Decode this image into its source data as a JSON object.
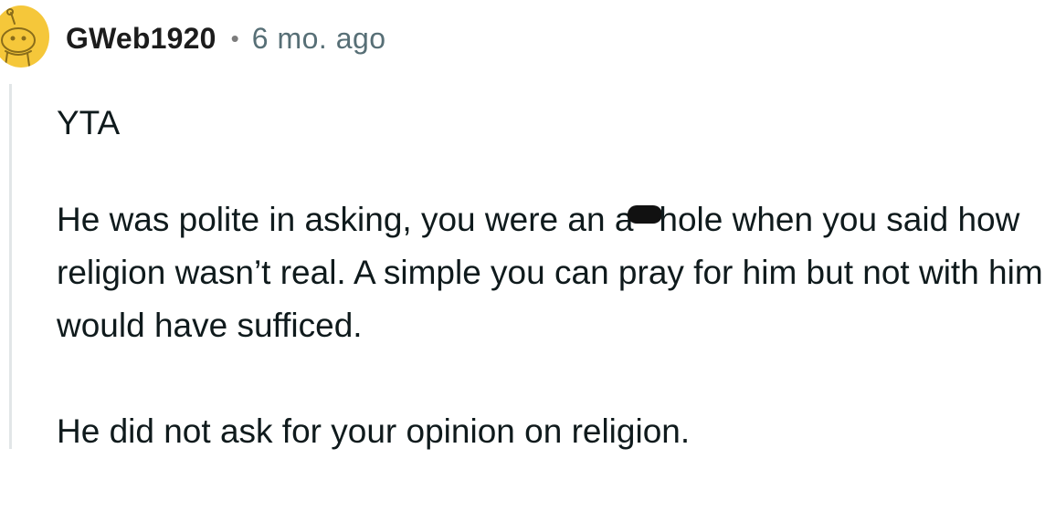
{
  "comment": {
    "author": "GWeb1920",
    "separator": "•",
    "timestamp": "6 mo. ago",
    "verdict": "YTA",
    "paragraph2_before": "He was polite in asking, you were an a",
    "paragraph2_after": "hole when you said how religion wasn’t real. A simple you can pray for him but not with him would have sufficed.",
    "paragraph3": "He did not ask for your opinion on religion."
  },
  "colors": {
    "avatar_bg": "#f5c73a",
    "username": "#1c1c1c",
    "timestamp": "#576f76",
    "thread_line": "#e2e6e8",
    "body_text": "#0f1a1c"
  },
  "icons": {
    "avatar": "snoo-avatar-icon"
  }
}
